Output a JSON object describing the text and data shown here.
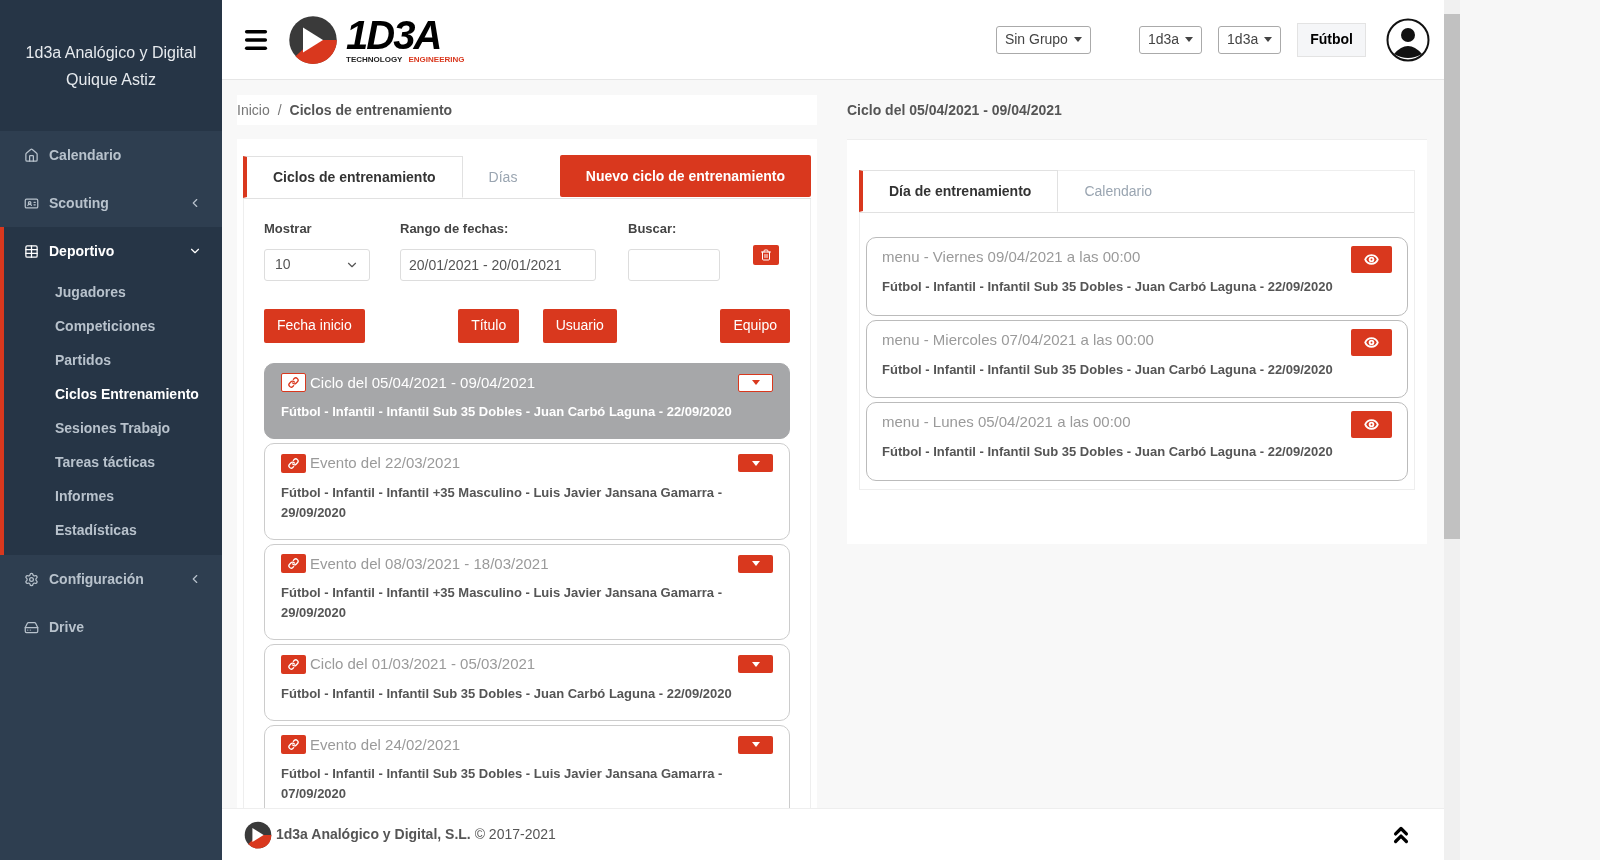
{
  "sidebar": {
    "org": "1d3a Analógico y Digital",
    "user": "Quique Astiz",
    "items": [
      {
        "label": "Calendario"
      },
      {
        "label": "Scouting",
        "expanded": false
      },
      {
        "label": "Deportivo",
        "expanded": true,
        "children": [
          {
            "label": "Jugadores",
            "selected": false
          },
          {
            "label": "Competiciones",
            "selected": false
          },
          {
            "label": "Partidos",
            "selected": false
          },
          {
            "label": "Ciclos Entrenamiento",
            "selected": true
          },
          {
            "label": "Sesiones Trabajo",
            "selected": false
          },
          {
            "label": "Tareas tácticas",
            "selected": false
          },
          {
            "label": "Informes",
            "selected": false
          },
          {
            "label": "Estadísticas",
            "selected": false
          }
        ]
      },
      {
        "label": "Configuración",
        "expanded": false
      },
      {
        "label": "Drive"
      }
    ]
  },
  "header": {
    "logo": "1D3A",
    "logo_sub": [
      "TECHNOLOGY",
      "ENGINEERING"
    ],
    "selects": [
      "Sin Grupo",
      "1d3a",
      "1d3a"
    ],
    "sport": "Fútbol"
  },
  "breadcrumb": {
    "items": [
      "Inicio",
      "Ciclos de entrenamiento"
    ],
    "separator": "/"
  },
  "cycles_panel": {
    "tabs": [
      {
        "label": "Ciclos de entrenamiento",
        "selected": true
      },
      {
        "label": "Días",
        "selected": false
      }
    ],
    "new_button": "Nuevo ciclo de entrenamiento",
    "show": {
      "label": "Mostrar",
      "value": "10"
    },
    "range": {
      "label": "Rango de fechas:",
      "value": "20/01/2021 - 20/01/2021"
    },
    "search": {
      "label": "Buscar:"
    },
    "sort_buttons": [
      "Fecha inicio",
      "Título",
      "Usuario",
      "Equipo"
    ],
    "items": [
      {
        "title": "Ciclo del 05/04/2021 - 09/04/2021",
        "detail": "Fútbol - Infantil - Infantil Sub 35 Dobles - Juan Carbó Laguna - 22/09/2020",
        "selected": true
      },
      {
        "title": "Evento del 22/03/2021",
        "detail": "Fútbol - Infantil - Infantil +35 Masculino - Luis Javier Jansana Gamarra - 29/09/2020",
        "selected": false
      },
      {
        "title": "Evento del 08/03/2021 - 18/03/2021",
        "detail": "Fútbol - Infantil - Infantil +35 Masculino - Luis Javier Jansana Gamarra - 29/09/2020",
        "selected": false
      },
      {
        "title": "Ciclo del 01/03/2021 - 05/03/2021",
        "detail": "Fútbol - Infantil - Infantil Sub 35 Dobles - Juan Carbó Laguna - 22/09/2020",
        "selected": false
      },
      {
        "title": "Evento del 24/02/2021",
        "detail": "Fútbol - Infantil - Infantil Sub 35 Dobles - Luis Javier Jansana Gamarra - 07/09/2020",
        "selected": false
      }
    ]
  },
  "detail_panel": {
    "title": "Ciclo del 05/04/2021 - 09/04/2021",
    "tabs": [
      {
        "label": "Día de entrenamiento",
        "selected": true
      },
      {
        "label": "Calendario",
        "selected": false
      }
    ],
    "days": [
      {
        "title": "menu - Viernes 09/04/2021 a las 00:00",
        "detail": "Fútbol - Infantil - Infantil Sub 35 Dobles - Juan Carbó Laguna - 22/09/2020"
      },
      {
        "title": "menu - Miercoles 07/04/2021 a las 00:00",
        "detail": "Fútbol - Infantil - Infantil Sub 35 Dobles - Juan Carbó Laguna - 22/09/2020"
      },
      {
        "title": "menu - Lunes 05/04/2021 a las 00:00",
        "detail": "Fútbol - Infantil - Infantil Sub 35 Dobles - Juan Carbó Laguna - 22/09/2020"
      }
    ]
  },
  "footer": {
    "company": "1d3a Analógico y Digital, S.L.",
    "copyright": "© 2017-2021"
  }
}
